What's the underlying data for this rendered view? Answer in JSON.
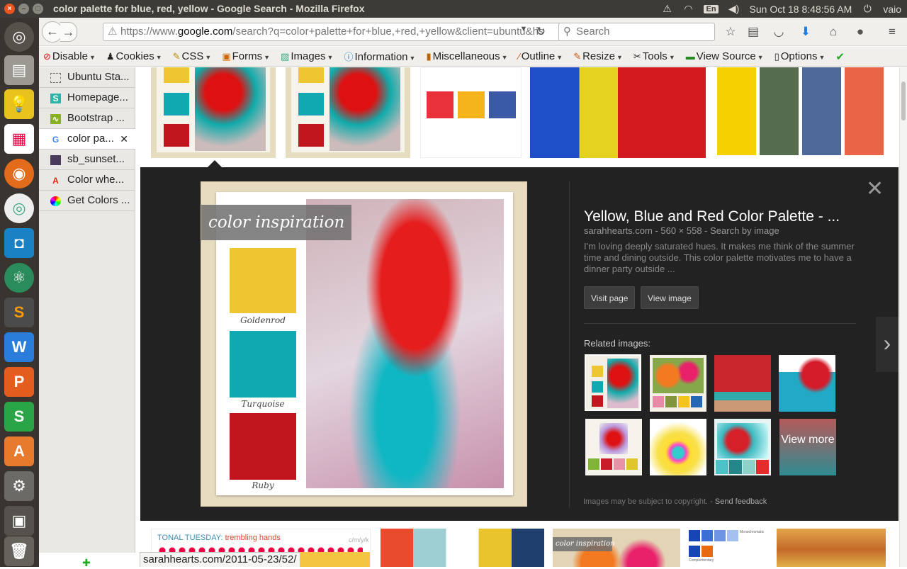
{
  "window": {
    "title": "color palette for blue, red, yellow - Google Search - Mozilla Firefox"
  },
  "tray": {
    "lang": "En",
    "datetime": "Sun Oct 18  8:48:56 AM",
    "user": "vaio"
  },
  "launcher": {
    "items": [
      "ubuntu-dash-icon",
      "files-icon",
      "notes-icon",
      "apps-icon",
      "firefox-icon",
      "chrome-icon",
      "pycharm-icon",
      "atom-icon",
      "sublime-icon",
      "wps-writer-icon",
      "wps-presentation-icon",
      "wps-spreadsheet-icon",
      "software-center-icon",
      "settings-icon",
      "workspace-icon",
      "trash-icon"
    ]
  },
  "nav": {
    "url_prefix": "https://www.",
    "url_domain": "google.com",
    "url_rest": "/search?q=color+palette+for+blue,+red,+yellow&client=ubuntu&hs",
    "search_placeholder": "Search"
  },
  "webdev": {
    "items": [
      "Disable",
      "Cookies",
      "CSS",
      "Forms",
      "Images",
      "Information",
      "Miscellaneous",
      "Outline",
      "Resize",
      "Tools",
      "View Source",
      "Options"
    ]
  },
  "tabs": [
    "Ubuntu Sta...",
    "Homepage...",
    "Bootstrap ...",
    "color pa...",
    "sb_sunset...",
    "Color whe...",
    "Get Colors ..."
  ],
  "panel": {
    "title": "Yellow, Blue and Red Color Palette - ...",
    "source": "sarahhearts.com - 560 × 558 - Search by image",
    "description": "I'm loving deeply saturated hues. It makes me think of the summer time and dining outside. This color palette motivates me to have a dinner party outside ...",
    "visit_label": "Visit page",
    "view_label": "View image",
    "related_label": "Related images:",
    "view_more": "View more",
    "footer_note": "Images may be subject to copyright.",
    "footer_sep": "-",
    "send_feedback": "Send feedback",
    "image_caption": "color inspiration",
    "swatches": [
      {
        "name": "Goldenrod",
        "color": "#efc631"
      },
      {
        "name": "Turquoise",
        "color": "#11a9b1"
      },
      {
        "name": "Ruby",
        "color": "#c1161e"
      }
    ]
  },
  "bottom": {
    "tonal_title": "TONAL TUESDAY:",
    "tonal_sub": "trembling hands",
    "cmyk": "c/m/y/k",
    "small_caption": "color inspiration",
    "mono": "Monochromatic",
    "complementary": "Complementary"
  },
  "status_url": "sarahhearts.com/2011-05-23/52/"
}
